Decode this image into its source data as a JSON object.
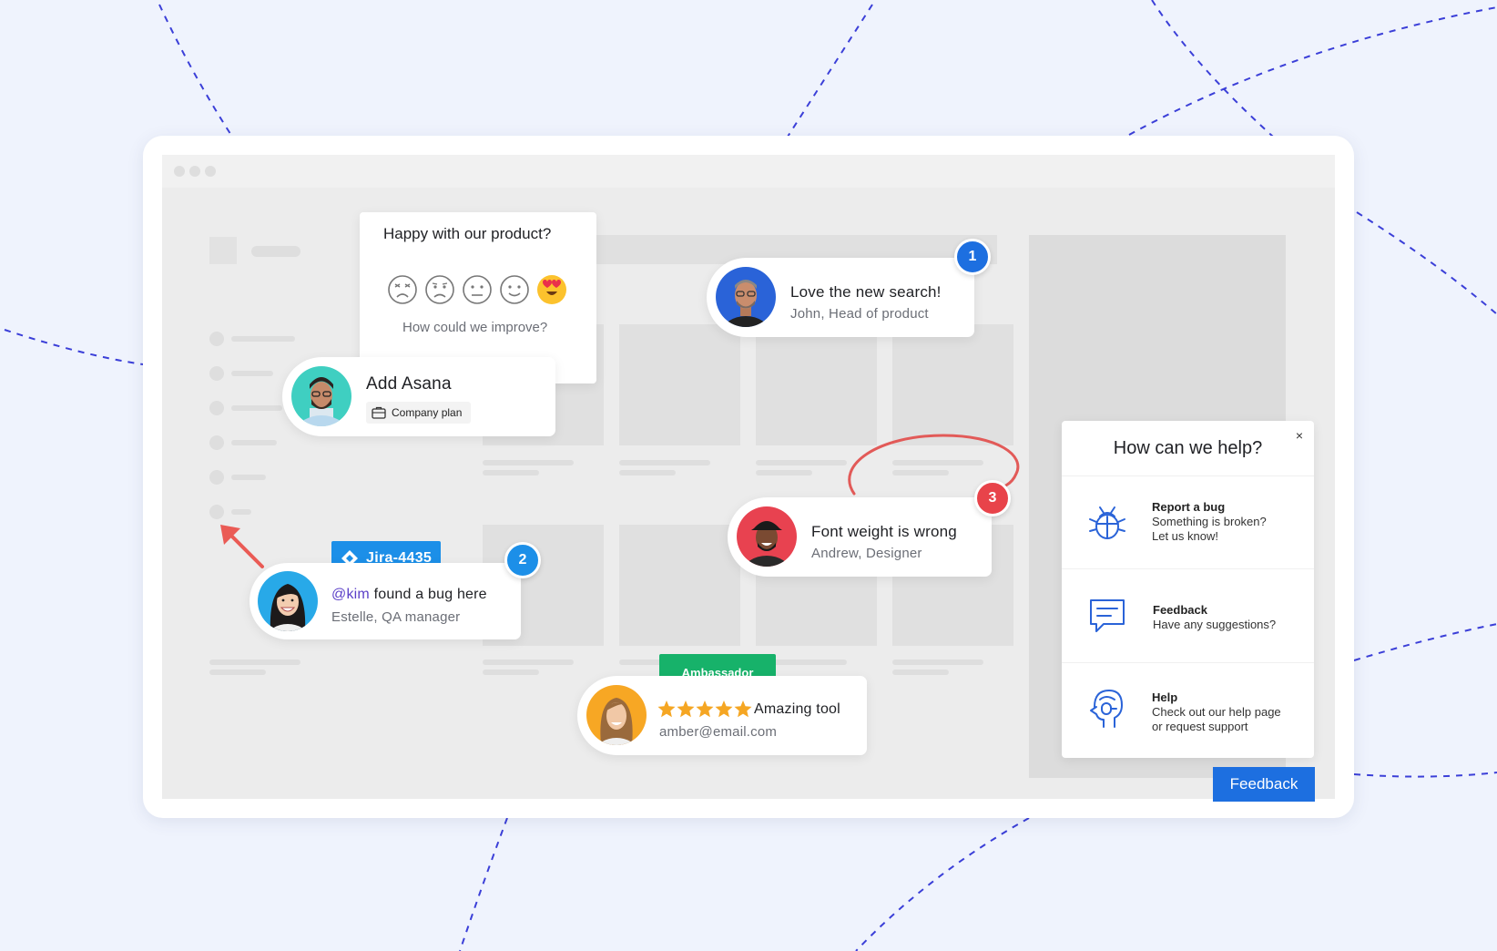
{
  "survey": {
    "question": "Happy with our product?",
    "prompt": "How could we improve?"
  },
  "integration": {
    "title": "Add Asana",
    "plan": "Company plan"
  },
  "comment_search": {
    "number": "1",
    "text": "Love the new search!",
    "author": "John, Head of product"
  },
  "comment_bug": {
    "number": "2",
    "ticket": "Jira-4435",
    "mention": "@kim",
    "text": " found a bug here",
    "author": "Estelle, QA manager"
  },
  "comment_font": {
    "number": "3",
    "text": "Font weight is wrong",
    "author": "Andrew, Designer"
  },
  "review": {
    "tag": "Ambassador",
    "rating": 5,
    "text": "Amazing tool",
    "email": "amber@email.com"
  },
  "help_panel": {
    "title": "How can we help?",
    "close": "×",
    "items": [
      {
        "title": "Report a bug",
        "sub1": "Something is broken?",
        "sub2": "Let us know!"
      },
      {
        "title": "Feedback",
        "sub1": "Have any suggestions?",
        "sub2": ""
      },
      {
        "title": "Help",
        "sub1": "Check out our help page",
        "sub2": "or request support"
      }
    ]
  },
  "feedback_button": "Feedback",
  "colors": {
    "accent_blue": "#1d6fe0",
    "badge_red": "#e8434a",
    "jira_blue": "#1c8fe8",
    "ambassador_green": "#17b26a",
    "star": "#f5a623",
    "dash": "#3b3fd8"
  }
}
